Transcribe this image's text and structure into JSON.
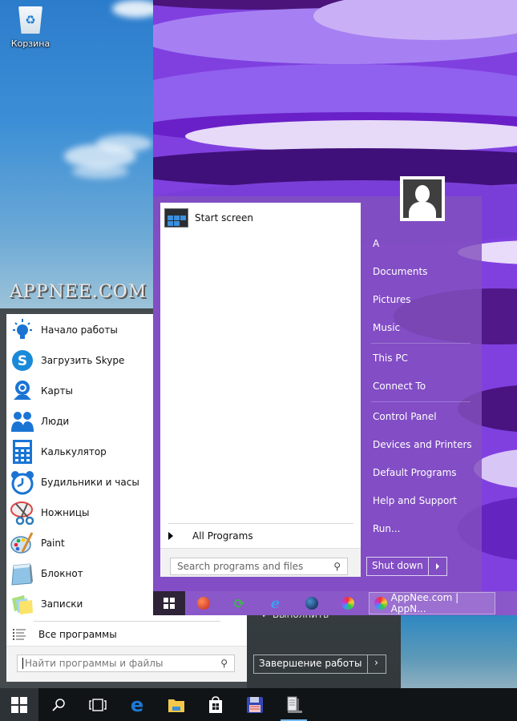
{
  "desktop": {
    "recycle_bin_label": "Корзина",
    "watermark": "APPNEE.COM"
  },
  "win10_start_menu": {
    "items": [
      {
        "label": "Начало работы",
        "icon": "lightbulb-icon"
      },
      {
        "label": "Загрузить Skype",
        "icon": "skype-icon"
      },
      {
        "label": "Карты",
        "icon": "maps-icon"
      },
      {
        "label": "Люди",
        "icon": "people-icon"
      },
      {
        "label": "Калькулятор",
        "icon": "calculator-icon"
      },
      {
        "label": "Будильники и часы",
        "icon": "alarm-clock-icon"
      },
      {
        "label": "Ножницы",
        "icon": "scissors-icon"
      },
      {
        "label": "Paint",
        "icon": "paint-palette-icon"
      },
      {
        "label": "Блокнот",
        "icon": "notepad-icon"
      },
      {
        "label": "Записки",
        "icon": "sticky-notes-icon"
      }
    ],
    "all_programs_label": "Все программы",
    "search_placeholder": "Найти программы и файлы",
    "shutdown_label": "Завершение работы",
    "run_partial_label": "Выполнить"
  },
  "win10_taskbar": {
    "icons": [
      "windows-start-icon",
      "search-icon",
      "task-view-icon",
      "edge-icon",
      "file-explorer-icon",
      "store-icon",
      "floppy-save-icon",
      "notepad-app-icon"
    ]
  },
  "classic_start_menu": {
    "pinned": [
      {
        "label": "Start screen",
        "icon": "start-screen-icon"
      }
    ],
    "all_programs_label": "All Programs",
    "search_placeholder": "Search programs and files",
    "right_items": [
      {
        "label": "A"
      },
      {
        "label": "Documents"
      },
      {
        "label": "Pictures"
      },
      {
        "label": "Music"
      },
      {
        "label": "This PC"
      },
      {
        "label": "Connect To"
      },
      {
        "label": "Control Panel"
      },
      {
        "label": "Devices and Printers"
      },
      {
        "label": "Default Programs"
      },
      {
        "label": "Help and Support"
      },
      {
        "label": "Run..."
      }
    ],
    "shutdown_label": "Shut down"
  },
  "classic_taskbar": {
    "icons": [
      "windows-start-icon",
      "redirect-app-icon",
      "sync-app-icon",
      "internet-explorer-icon",
      "globe-app-icon",
      "color-ball-app-icon"
    ],
    "active_task_label": "AppNee.com | AppN..."
  },
  "colors": {
    "accent_purple": "#8a58c8",
    "win10_dark": "#101417"
  }
}
